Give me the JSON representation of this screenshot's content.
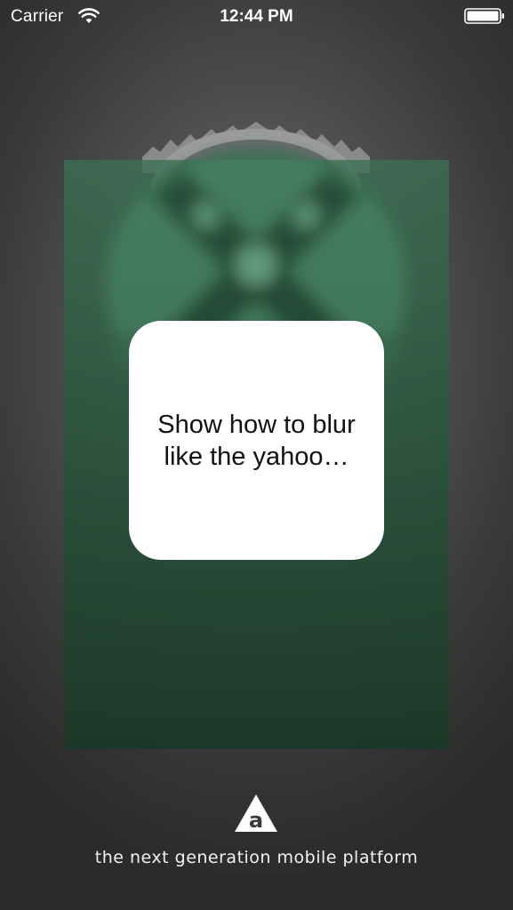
{
  "status_bar": {
    "carrier": "Carrier",
    "time": "12:44 PM",
    "wifi_icon": "wifi-icon",
    "battery_icon": "battery-icon"
  },
  "background": {
    "logo_icon": "appcelerator-x-logo-icon"
  },
  "panel": {
    "color": "#2f6046"
  },
  "card": {
    "text": "Show how to blur like the yahoo…"
  },
  "footer": {
    "logo_icon": "appcelerator-a-logo-icon",
    "tagline": "the next generation mobile platform"
  }
}
